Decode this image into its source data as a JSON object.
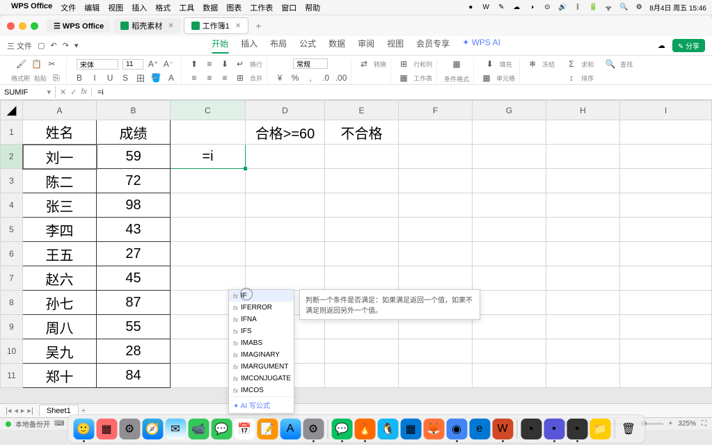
{
  "mac_menu": {
    "app": "WPS Office",
    "items": [
      "文件",
      "编辑",
      "视图",
      "插入",
      "格式",
      "工具",
      "数据",
      "图表",
      "工作表",
      "窗口",
      "帮助"
    ],
    "date": "8月4日 周五 15:46"
  },
  "tabs": {
    "t1": "稻壳素材",
    "t2": "工作簿1"
  },
  "ribbon": {
    "file": "三 文件",
    "tabs": [
      "开始",
      "插入",
      "布局",
      "公式",
      "数据",
      "审阅",
      "视图",
      "会员专享"
    ],
    "active": "开始",
    "wpsai": "WPS AI",
    "share": "分享"
  },
  "toolbar": {
    "format_painter": "格式刷",
    "paste": "粘贴",
    "font_name": "宋体",
    "font_size": "11",
    "general": "常规",
    "convert": "转换",
    "rowcol": "行和列",
    "worksheet": "工作表",
    "condfmt": "条件格式",
    "fill": "填充",
    "cellfmt": "单元格",
    "freeze": "冻结",
    "sum": "求和",
    "sort": "排序",
    "find": "查找"
  },
  "formula_bar": {
    "name": "SUMIF",
    "formula": "=i"
  },
  "columns": [
    "A",
    "B",
    "C",
    "D",
    "E",
    "F",
    "G",
    "H",
    "I"
  ],
  "rows": [
    "1",
    "2",
    "3",
    "4",
    "5",
    "6",
    "7",
    "8",
    "9",
    "10",
    "11"
  ],
  "cells": {
    "A1": "姓名",
    "B1": "成绩",
    "A2": "刘一",
    "B2": "59",
    "A3": "陈二",
    "B3": "72",
    "A4": "张三",
    "B4": "98",
    "A5": "李四",
    "B5": "43",
    "A6": "王五",
    "B6": "27",
    "A7": "赵六",
    "B7": "45",
    "A8": "孙七",
    "B8": "87",
    "A9": "周八",
    "B9": "55",
    "A10": "吴九",
    "B10": "28",
    "A11": "郑十",
    "B11": "84",
    "C2": "=i",
    "D1": "合格>=60",
    "E1": "不合格"
  },
  "autocomplete": {
    "items": [
      "IF",
      "IFERROR",
      "IFNA",
      "IFS",
      "IMABS",
      "IMAGINARY",
      "IMARGUMENT",
      "IMCONJUGATE",
      "IMCOS"
    ],
    "ai": "AI 写公式",
    "tooltip": "判断一个条件是否满足：如果满足返回一个值，如果不满足则返回另外一个值。"
  },
  "sheet": {
    "name": "Sheet1"
  },
  "status": {
    "text": "本地备份开",
    "zoom": "325%"
  }
}
